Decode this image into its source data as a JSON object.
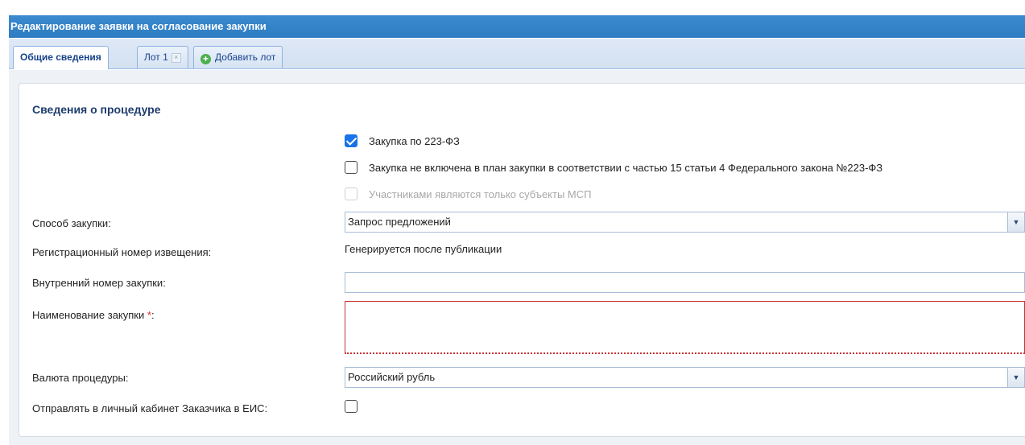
{
  "window": {
    "title": "Редактирование заявки на согласование закупки"
  },
  "tabs": [
    {
      "label": "Общие сведения",
      "active": true
    },
    {
      "label": "Лот 1",
      "closable": true
    },
    {
      "label": "Добавить лот",
      "icon": "add-icon"
    }
  ],
  "section": {
    "title": "Сведения о процедуре"
  },
  "checkboxes": {
    "fz223": {
      "label": "Закупка по 223-ФЗ",
      "checked": true
    },
    "not_in_plan": {
      "label": "Закупка не включена в план закупки в соответствии с частью 15 статьи 4 Федерального закона №223-ФЗ",
      "checked": false
    },
    "msp_only": {
      "label": "Участниками являются только субъекты МСП",
      "checked": false,
      "disabled": true
    }
  },
  "form": {
    "method": {
      "label": "Способ закупки:",
      "value": "Запрос предложений"
    },
    "reg_number": {
      "label": "Регистрационный номер извещения:",
      "value": "Генерируется после публикации"
    },
    "internal_number": {
      "label": "Внутренний номер закупки:",
      "value": ""
    },
    "name": {
      "label": "Наименование закупки",
      "required_mark": "*",
      "label_suffix": ":",
      "value": ""
    },
    "currency": {
      "label": "Валюта процедуры:",
      "value": "Российский рубль"
    },
    "send_eis": {
      "label": "Отправлять в личный кабинет Заказчика в ЕИС:",
      "checked": false
    }
  },
  "colors": {
    "header": "#2e7cc2",
    "required": "#e02020",
    "checkbox_checked": "#1a73e8"
  }
}
